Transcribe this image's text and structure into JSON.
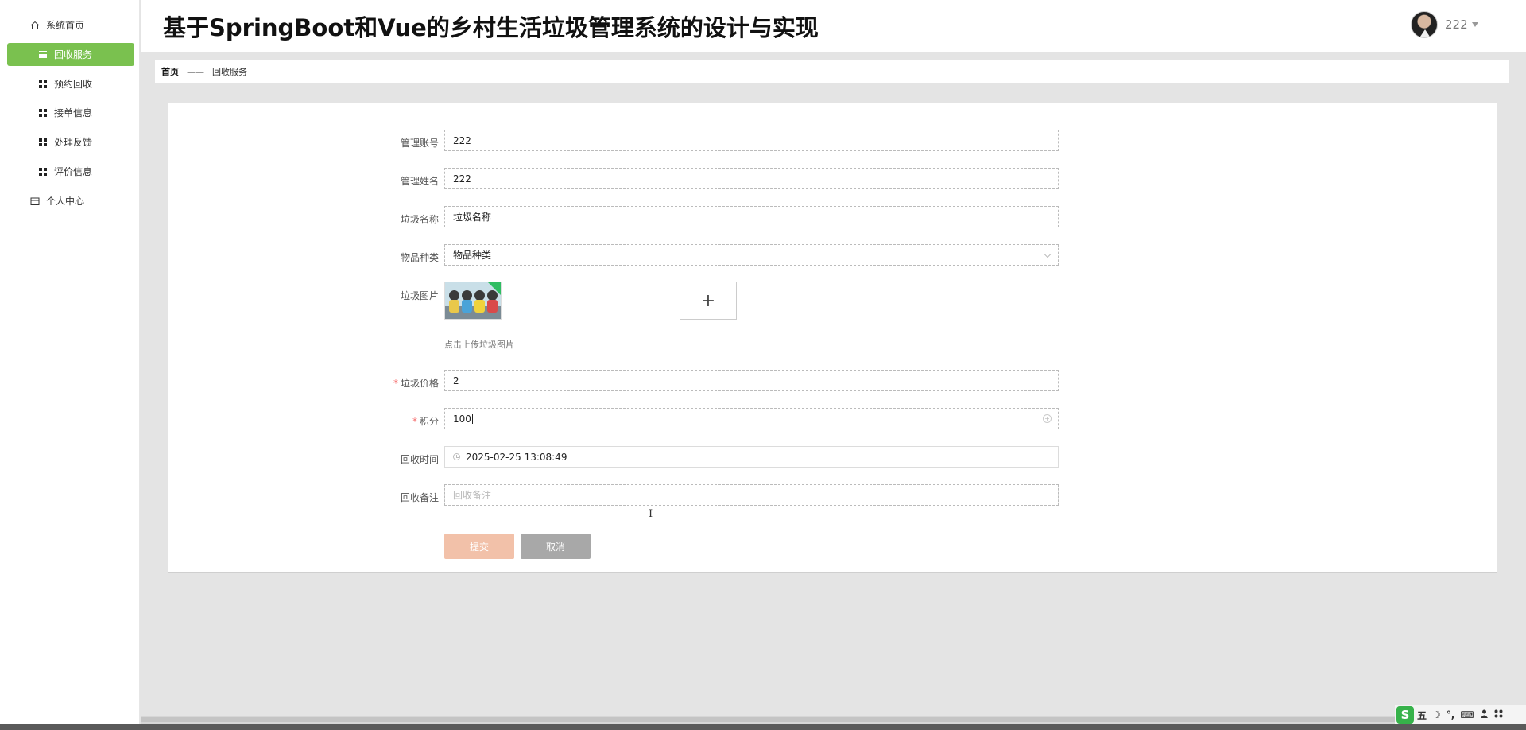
{
  "app": {
    "title": "基于SpringBoot和Vue的乡村生活垃圾管理系统的设计与实现"
  },
  "user": {
    "name": "222"
  },
  "sidebar": {
    "items": [
      {
        "label": "系统首页"
      },
      {
        "label": "回收服务"
      },
      {
        "label": "预约回收"
      },
      {
        "label": "接单信息"
      },
      {
        "label": "处理反馈"
      },
      {
        "label": "评价信息"
      },
      {
        "label": "个人中心"
      }
    ]
  },
  "breadcrumb": {
    "home": "首页",
    "separator": "——",
    "current": "回收服务"
  },
  "form": {
    "account": {
      "label": "管理账号",
      "value": "222"
    },
    "name": {
      "label": "管理姓名",
      "value": "222"
    },
    "garbage_name": {
      "label": "垃圾名称",
      "value": "垃圾名称"
    },
    "category": {
      "label": "物品种类",
      "value": "物品种类"
    },
    "image": {
      "label": "垃圾图片",
      "upload_tip": "点击上传垃圾图片",
      "upload_symbol": "+"
    },
    "price": {
      "required": "*",
      "label": "垃圾价格",
      "value": "2"
    },
    "points": {
      "required": "*",
      "label": "积分",
      "value": "100"
    },
    "recycle_time": {
      "label": "回收时间",
      "value": "2025-02-25 13:08:49"
    },
    "remark": {
      "label": "回收备注",
      "placeholder": "回收备注"
    },
    "submit_label": "提交",
    "cancel_label": "取消"
  },
  "ime": {
    "logo": "S",
    "mode": "五",
    "moon": "☽",
    "punct": "°,",
    "keyboard": "⌨"
  },
  "colors": {
    "accent": "#7ac14f",
    "submit": "#f2c1a9",
    "cancel": "#a8a8a8",
    "required": "#f56c6c"
  },
  "icons": [
    "home-icon",
    "list-icon",
    "grid-icon",
    "user-center-icon",
    "clock-icon",
    "chevron-down-icon",
    "plus-circle-icon",
    "plus-icon"
  ]
}
